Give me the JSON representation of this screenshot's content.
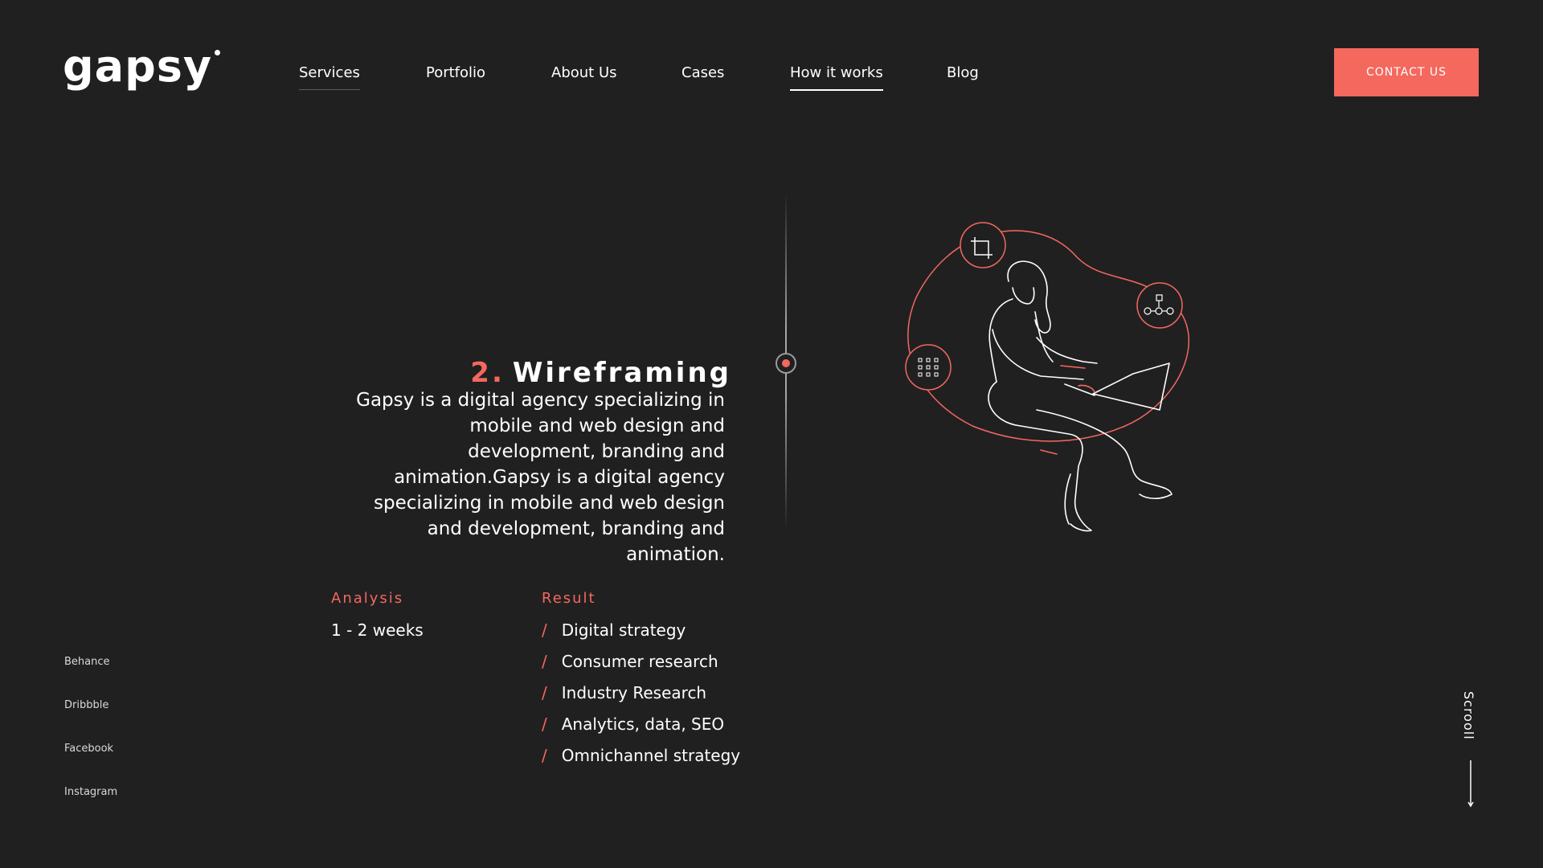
{
  "brand": {
    "name": "gapsy"
  },
  "nav": {
    "items": [
      {
        "label": "Services"
      },
      {
        "label": "Portfolio"
      },
      {
        "label": "About Us"
      },
      {
        "label": "Cases"
      },
      {
        "label": "How it works"
      },
      {
        "label": "Blog"
      }
    ],
    "active": "How it works",
    "hover": "Services",
    "contact_label": "CONTACT US"
  },
  "step": {
    "number": "2.",
    "title": "Wireframing",
    "description": "Gapsy is a digital agency specializing in mobile and web design and development, branding and animation.Gapsy is a digital agency specializing in mobile and web design and development, branding and animation."
  },
  "analysis": {
    "label": "Analysis",
    "value": "1 - 2 weeks"
  },
  "result": {
    "label": "Result",
    "items": [
      "Digital strategy",
      "Consumer research",
      "Industry Research",
      "Analytics, data, SEO",
      "Omnichannel strategy"
    ]
  },
  "socials": [
    "Behance",
    "Dribbble",
    "Facebook",
    "Instagram"
  ],
  "scroll_label": "Scrooll",
  "icons": {
    "crop": "crop-icon",
    "flowchart": "flowchart-icon",
    "grid": "grid-icon",
    "arrow": "arrow-down-icon"
  },
  "colors": {
    "background": "#202021",
    "accent": "#f4685e",
    "text": "#ffffff"
  }
}
